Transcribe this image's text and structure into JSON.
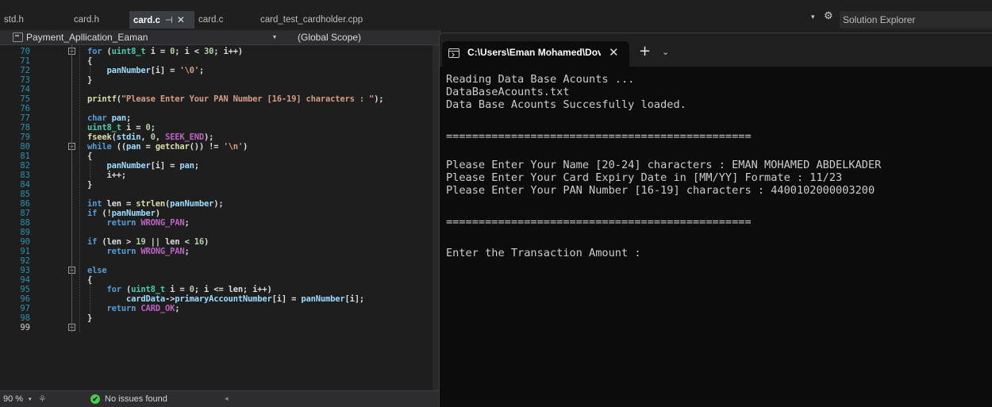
{
  "ide": {
    "tabs": [
      {
        "label": "std.h",
        "active": false
      },
      {
        "label": "card.h",
        "active": false
      },
      {
        "label": "card.c",
        "active": true,
        "pin": "⊣",
        "close": "✕"
      },
      {
        "label": "card.c",
        "active": false
      },
      {
        "label": "card_test_cardholder.cpp",
        "active": false
      }
    ],
    "solution_explorer": {
      "title": "Solution Explorer",
      "dropdown": "▾",
      "settings": "⚙"
    },
    "nav": {
      "project": "Payment_Apllication_Eaman",
      "dropdown": "▾",
      "scope": "(Global Scope)"
    },
    "status": {
      "zoom": "90 %",
      "zoom_dropdown": "▾",
      "issues": "No issues found",
      "ok_mark": "✔",
      "scroll_left": "◂"
    }
  },
  "editor": {
    "lines": [
      {
        "num": "70",
        "segs": [
          [
            "k",
            "for"
          ],
          [
            "p",
            " ("
          ],
          [
            "t",
            "uint8_t"
          ],
          [
            "p",
            " i = "
          ],
          [
            "n",
            "0"
          ],
          [
            "p",
            "; i < "
          ],
          [
            "n",
            "30"
          ],
          [
            "p",
            "; i++)"
          ]
        ]
      },
      {
        "num": "71",
        "segs": [
          [
            "p",
            "{"
          ]
        ]
      },
      {
        "num": "72",
        "segs": [
          [
            "p",
            "    "
          ],
          [
            "v",
            "panNumber"
          ],
          [
            "p",
            "[i] = "
          ],
          [
            "s",
            "'\\0'"
          ],
          [
            "p",
            ";"
          ]
        ]
      },
      {
        "num": "73",
        "segs": [
          [
            "p",
            "}"
          ]
        ]
      },
      {
        "num": "74",
        "segs": []
      },
      {
        "num": "75",
        "segs": [
          [
            "f",
            "printf"
          ],
          [
            "p",
            "("
          ],
          [
            "s",
            "\"Please Enter Your PAN Number [16-19] characters : \""
          ],
          [
            "p",
            ");"
          ]
        ]
      },
      {
        "num": "76",
        "segs": []
      },
      {
        "num": "77",
        "segs": [
          [
            "k",
            "char"
          ],
          [
            "p",
            " "
          ],
          [
            "v",
            "pan"
          ],
          [
            "p",
            ";"
          ]
        ]
      },
      {
        "num": "78",
        "segs": [
          [
            "t",
            "uint8_t"
          ],
          [
            "p",
            " i = "
          ],
          [
            "n",
            "0"
          ],
          [
            "p",
            ";"
          ]
        ]
      },
      {
        "num": "79",
        "segs": [
          [
            "f",
            "fseek"
          ],
          [
            "p",
            "("
          ],
          [
            "v",
            "stdin"
          ],
          [
            "p",
            ", "
          ],
          [
            "n",
            "0"
          ],
          [
            "p",
            ", "
          ],
          [
            "m",
            "SEEK_END"
          ],
          [
            "p",
            ");"
          ]
        ]
      },
      {
        "num": "80",
        "segs": [
          [
            "k",
            "while"
          ],
          [
            "p",
            " (("
          ],
          [
            "v",
            "pan"
          ],
          [
            "p",
            " = "
          ],
          [
            "f",
            "getchar"
          ],
          [
            "p",
            "()) != "
          ],
          [
            "s",
            "'\\n'"
          ],
          [
            "p",
            ")"
          ]
        ]
      },
      {
        "num": "81",
        "segs": [
          [
            "p",
            "{"
          ]
        ]
      },
      {
        "num": "82",
        "segs": [
          [
            "p",
            "    "
          ],
          [
            "v",
            "panNumber"
          ],
          [
            "p",
            "[i] = "
          ],
          [
            "v",
            "pan"
          ],
          [
            "p",
            ";"
          ]
        ]
      },
      {
        "num": "83",
        "segs": [
          [
            "p",
            "    i++;"
          ]
        ]
      },
      {
        "num": "84",
        "segs": [
          [
            "p",
            "}"
          ]
        ]
      },
      {
        "num": "85",
        "segs": []
      },
      {
        "num": "86",
        "segs": [
          [
            "k",
            "int"
          ],
          [
            "p",
            " len = "
          ],
          [
            "f",
            "strlen"
          ],
          [
            "p",
            "("
          ],
          [
            "v",
            "panNumber"
          ],
          [
            "p",
            ");"
          ]
        ]
      },
      {
        "num": "87",
        "segs": [
          [
            "k",
            "if"
          ],
          [
            "p",
            " (!"
          ],
          [
            "v",
            "panNumber"
          ],
          [
            "p",
            ")"
          ]
        ]
      },
      {
        "num": "88",
        "segs": [
          [
            "p",
            "    "
          ],
          [
            "k",
            "return"
          ],
          [
            "p",
            " "
          ],
          [
            "m",
            "WRONG_PAN"
          ],
          [
            "p",
            ";"
          ]
        ]
      },
      {
        "num": "89",
        "segs": []
      },
      {
        "num": "90",
        "segs": [
          [
            "k",
            "if"
          ],
          [
            "p",
            " (len > "
          ],
          [
            "n",
            "19"
          ],
          [
            "p",
            " || len < "
          ],
          [
            "n",
            "16"
          ],
          [
            "p",
            ")"
          ]
        ]
      },
      {
        "num": "91",
        "segs": [
          [
            "p",
            "    "
          ],
          [
            "k",
            "return"
          ],
          [
            "p",
            " "
          ],
          [
            "m",
            "WRONG_PAN"
          ],
          [
            "p",
            ";"
          ]
        ]
      },
      {
        "num": "92",
        "segs": []
      },
      {
        "num": "93",
        "segs": [
          [
            "k",
            "else"
          ]
        ]
      },
      {
        "num": "94",
        "segs": [
          [
            "p",
            "{"
          ]
        ]
      },
      {
        "num": "95",
        "segs": [
          [
            "p",
            "    "
          ],
          [
            "k",
            "for"
          ],
          [
            "p",
            " ("
          ],
          [
            "t",
            "uint8_t"
          ],
          [
            "p",
            " i = "
          ],
          [
            "n",
            "0"
          ],
          [
            "p",
            "; i <= len; i++)"
          ]
        ]
      },
      {
        "num": "96",
        "segs": [
          [
            "p",
            "        "
          ],
          [
            "v",
            "cardData"
          ],
          [
            "p",
            "->"
          ],
          [
            "v",
            "primaryAccountNumber"
          ],
          [
            "p",
            "[i] = "
          ],
          [
            "v",
            "panNumber"
          ],
          [
            "p",
            "[i];"
          ]
        ]
      },
      {
        "num": "97",
        "segs": [
          [
            "p",
            "    "
          ],
          [
            "k",
            "return"
          ],
          [
            "p",
            " "
          ],
          [
            "m",
            "CARD_OK"
          ],
          [
            "p",
            ";"
          ]
        ]
      },
      {
        "num": "98",
        "segs": [
          [
            "p",
            "}"
          ]
        ]
      },
      {
        "num": "99",
        "segs": []
      }
    ]
  },
  "terminal": {
    "tab_title": "C:\\Users\\Eman Mohamed\\Dov",
    "close": "✕",
    "new_tab": "+",
    "dropdown": "⌄",
    "lines": [
      "Reading Data Base Acounts ...",
      "DataBaseAcounts.txt",
      "Data Base Acounts Succesfully loaded.",
      "",
      "===============================================",
      "",
      "Please Enter Your Name [20-24] characters : EMAN MOHAMED ABDELKADER",
      "Please Enter Your Card Expiry Date in [MM/YY] Formate : 11/23",
      "Please Enter Your PAN Number [16-19] characters : 4400102000003200",
      "",
      "===============================================",
      "",
      "Enter the Transaction Amount :"
    ]
  }
}
